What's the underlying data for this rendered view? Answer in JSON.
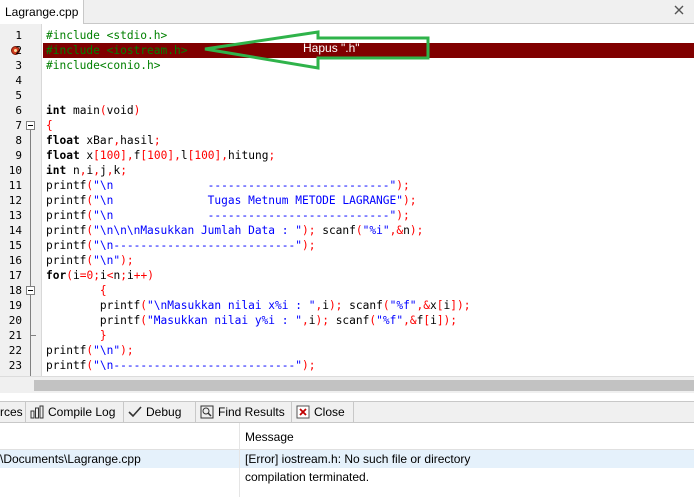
{
  "tab": {
    "filename": "Lagrange.cpp"
  },
  "annotation": {
    "label": "Hapus \".h\"",
    "arrow_color": "#2fb34a",
    "highlight_color": "#800000"
  },
  "code_lines": [
    {
      "num": "1",
      "parts": [
        [
          "pp",
          "#include <stdio.h>"
        ]
      ]
    },
    {
      "num": "2",
      "error": true,
      "parts": [
        [
          "pp",
          "#include <iostream.h>"
        ]
      ]
    },
    {
      "num": "3",
      "parts": [
        [
          "pp",
          "#include<conio.h>"
        ]
      ]
    },
    {
      "num": "4",
      "parts": []
    },
    {
      "num": "5",
      "parts": []
    },
    {
      "num": "6",
      "parts": [
        [
          "kw",
          "int"
        ],
        [
          "",
          " main"
        ],
        [
          "red",
          "("
        ],
        [
          "",
          "void"
        ],
        [
          "red",
          ")"
        ]
      ]
    },
    {
      "num": "7",
      "fold": "start",
      "parts": [
        [
          "red",
          "{"
        ]
      ]
    },
    {
      "num": "8",
      "parts": [
        [
          "kw",
          "float"
        ],
        [
          "",
          " xBar"
        ],
        [
          "red",
          ","
        ],
        [
          "",
          "hasil"
        ],
        [
          "red",
          ";"
        ]
      ]
    },
    {
      "num": "9",
      "parts": [
        [
          "kw",
          "float"
        ],
        [
          "",
          " x"
        ],
        [
          "red",
          "["
        ],
        [
          "num",
          "100"
        ],
        [
          "red",
          "],"
        ],
        [
          "",
          "f"
        ],
        [
          "red",
          "["
        ],
        [
          "num",
          "100"
        ],
        [
          "red",
          "],"
        ],
        [
          "",
          "l"
        ],
        [
          "red",
          "["
        ],
        [
          "num",
          "100"
        ],
        [
          "red",
          "],"
        ],
        [
          "",
          "hitung"
        ],
        [
          "red",
          ";"
        ]
      ]
    },
    {
      "num": "10",
      "parts": [
        [
          "kw",
          "int"
        ],
        [
          "",
          " n"
        ],
        [
          "red",
          ","
        ],
        [
          "",
          "i"
        ],
        [
          "red",
          ","
        ],
        [
          "",
          "j"
        ],
        [
          "red",
          ","
        ],
        [
          "",
          "k"
        ],
        [
          "red",
          ";"
        ]
      ]
    },
    {
      "num": "11",
      "parts": [
        [
          "",
          "printf"
        ],
        [
          "red",
          "("
        ],
        [
          "str",
          "\"\\n              ---------------------------\""
        ],
        [
          "red",
          ");"
        ]
      ]
    },
    {
      "num": "12",
      "parts": [
        [
          "",
          "printf"
        ],
        [
          "red",
          "("
        ],
        [
          "str",
          "\"\\n              Tugas Metnum METODE LAGRANGE\""
        ],
        [
          "red",
          ");"
        ]
      ]
    },
    {
      "num": "13",
      "parts": [
        [
          "",
          "printf"
        ],
        [
          "red",
          "("
        ],
        [
          "str",
          "\"\\n              ---------------------------\""
        ],
        [
          "red",
          ");"
        ]
      ]
    },
    {
      "num": "14",
      "parts": [
        [
          "",
          "printf"
        ],
        [
          "red",
          "("
        ],
        [
          "str",
          "\"\\n\\n\\nMasukkan Jumlah Data : \""
        ],
        [
          "red",
          ");"
        ],
        [
          "",
          " scanf"
        ],
        [
          "red",
          "("
        ],
        [
          "str",
          "\"%i\""
        ],
        [
          "red",
          ",&"
        ],
        [
          "",
          "n"
        ],
        [
          "red",
          ");"
        ]
      ]
    },
    {
      "num": "15",
      "parts": [
        [
          "",
          "printf"
        ],
        [
          "red",
          "("
        ],
        [
          "str",
          "\"\\n---------------------------\""
        ],
        [
          "red",
          ");"
        ]
      ]
    },
    {
      "num": "16",
      "parts": [
        [
          "",
          "printf"
        ],
        [
          "red",
          "("
        ],
        [
          "str",
          "\"\\n\""
        ],
        [
          "red",
          ");"
        ]
      ]
    },
    {
      "num": "17",
      "parts": [
        [
          "kw",
          "for"
        ],
        [
          "red",
          "("
        ],
        [
          "",
          "i"
        ],
        [
          "red",
          "="
        ],
        [
          "num",
          "0"
        ],
        [
          "red",
          ";"
        ],
        [
          "",
          "i"
        ],
        [
          "red",
          "<"
        ],
        [
          "",
          "n"
        ],
        [
          "red",
          ";"
        ],
        [
          "",
          "i"
        ],
        [
          "red",
          "++)"
        ]
      ]
    },
    {
      "num": "18",
      "fold": "start",
      "parts": [
        [
          "",
          "        "
        ],
        [
          "red",
          "{"
        ]
      ]
    },
    {
      "num": "19",
      "parts": [
        [
          "",
          "        printf"
        ],
        [
          "red",
          "("
        ],
        [
          "str",
          "\"\\nMasukkan nilai x%i : \""
        ],
        [
          "red",
          ","
        ],
        [
          "",
          "i"
        ],
        [
          "red",
          ");"
        ],
        [
          "",
          " scanf"
        ],
        [
          "red",
          "("
        ],
        [
          "str",
          "\"%f\""
        ],
        [
          "red",
          ",&"
        ],
        [
          "",
          "x"
        ],
        [
          "red",
          "["
        ],
        [
          "",
          "i"
        ],
        [
          "red",
          "]);"
        ]
      ]
    },
    {
      "num": "20",
      "parts": [
        [
          "",
          "        printf"
        ],
        [
          "red",
          "("
        ],
        [
          "str",
          "\"Masukkan nilai y%i : \""
        ],
        [
          "red",
          ","
        ],
        [
          "",
          "i"
        ],
        [
          "red",
          ");"
        ],
        [
          "",
          " scanf"
        ],
        [
          "red",
          "("
        ],
        [
          "str",
          "\"%f\""
        ],
        [
          "red",
          ",&"
        ],
        [
          "",
          "f"
        ],
        [
          "red",
          "["
        ],
        [
          "",
          "i"
        ],
        [
          "red",
          "]);"
        ]
      ]
    },
    {
      "num": "21",
      "fold": "end",
      "parts": [
        [
          "",
          "        "
        ],
        [
          "red",
          "}"
        ]
      ]
    },
    {
      "num": "22",
      "parts": [
        [
          "",
          "printf"
        ],
        [
          "red",
          "("
        ],
        [
          "str",
          "\"\\n\""
        ],
        [
          "red",
          ");"
        ]
      ]
    },
    {
      "num": "23",
      "parts": [
        [
          "",
          "printf"
        ],
        [
          "red",
          "("
        ],
        [
          "str",
          "\"\\n---------------------------\""
        ],
        [
          "red",
          ");"
        ]
      ]
    }
  ],
  "bottom_tabs": [
    {
      "label": "rces",
      "icon": "resources-icon"
    },
    {
      "label": "Compile Log",
      "icon": "compile-log-icon"
    },
    {
      "label": "Debug",
      "icon": "debug-check-icon"
    },
    {
      "label": "Find Results",
      "icon": "find-results-icon"
    },
    {
      "label": "Close",
      "icon": "close-icon"
    }
  ],
  "messages": {
    "header_message": "Message",
    "rows": [
      {
        "file": "\\Documents\\Lagrange.cpp",
        "message": "[Error] iostream.h: No such file or directory",
        "selected": true
      },
      {
        "file": "",
        "message": "compilation terminated.",
        "selected": false
      }
    ]
  }
}
